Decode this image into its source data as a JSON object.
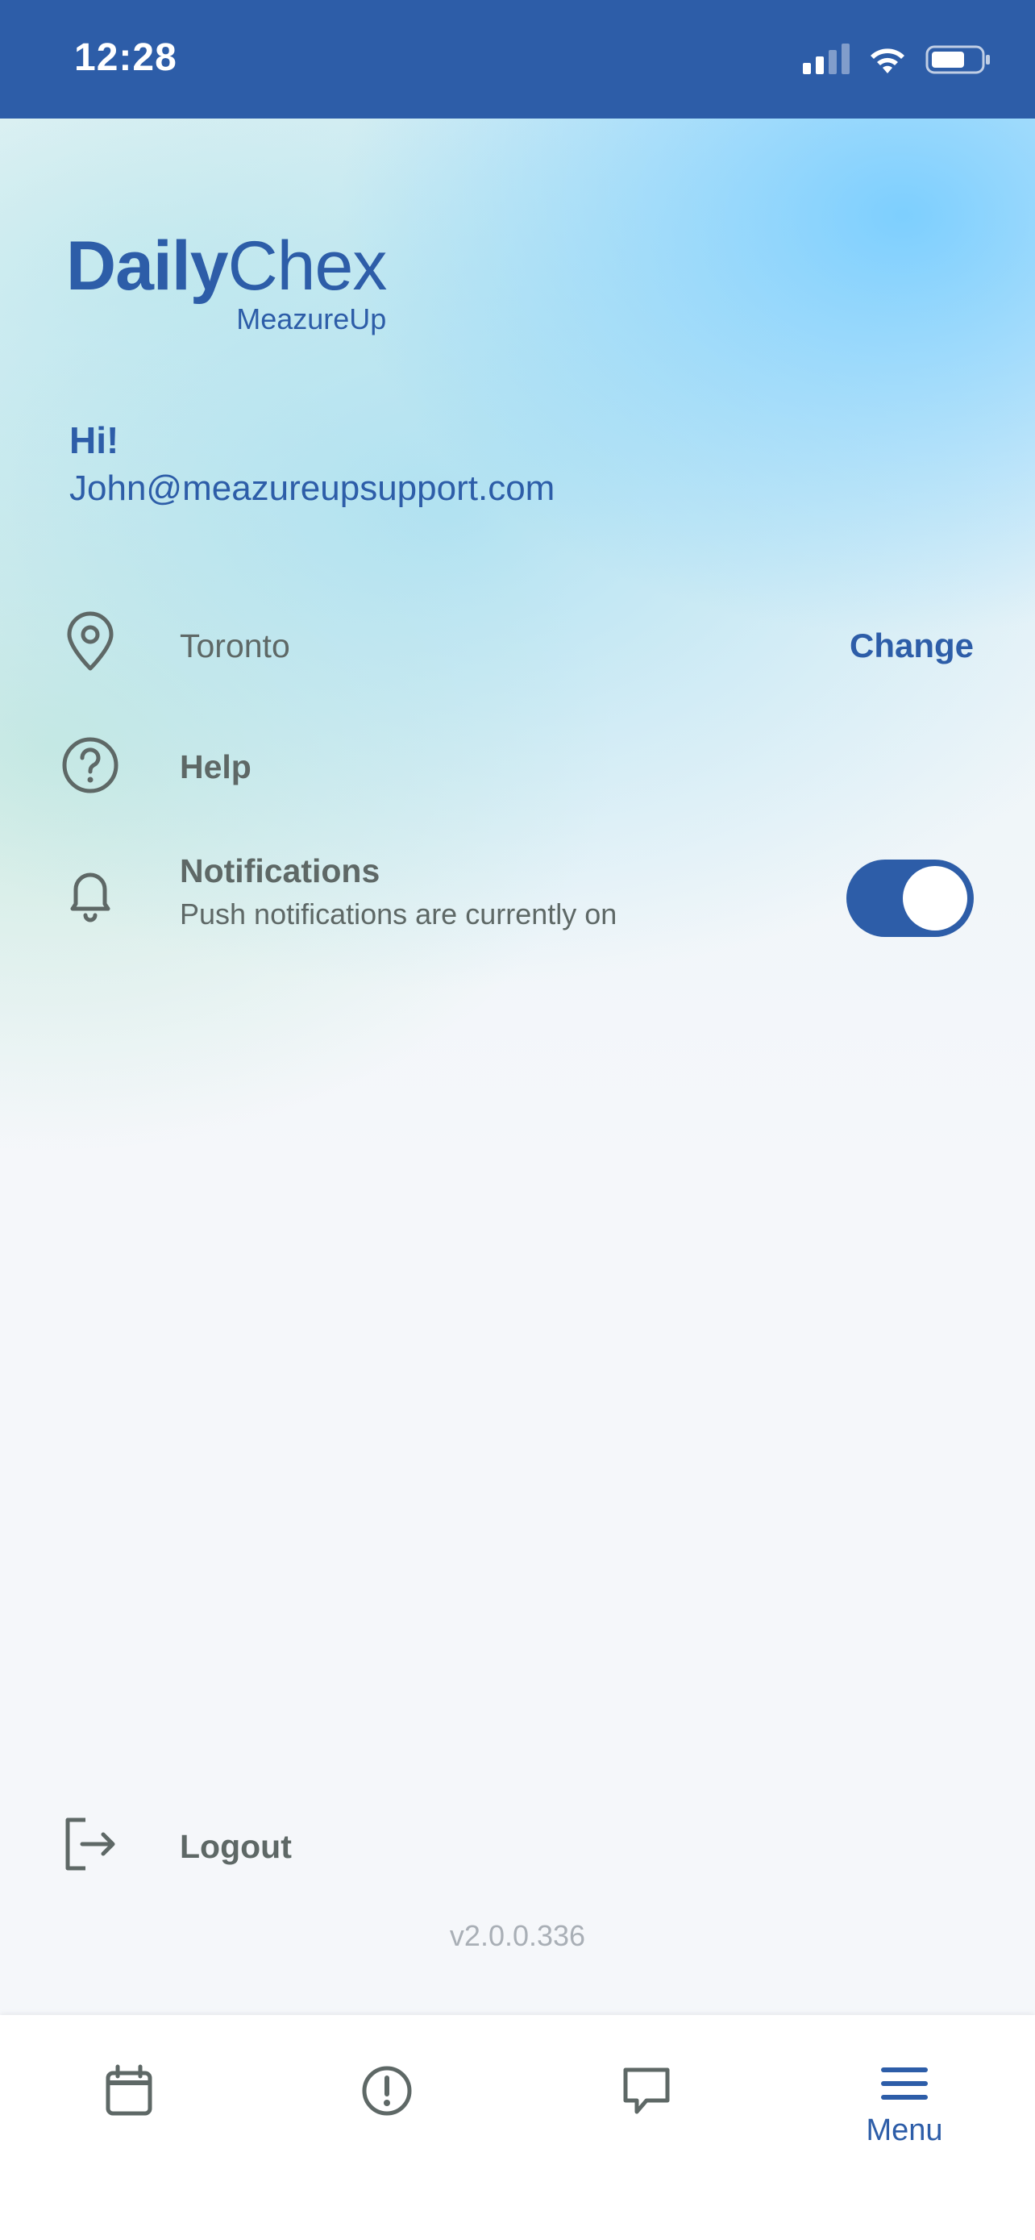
{
  "status_bar": {
    "time": "12:28"
  },
  "logo": {
    "main_bold": "Daily",
    "main_regular": "Chex",
    "sub": "MeazureUp"
  },
  "greeting": {
    "hi": "Hi!",
    "email": "John@meazureupsupport.com"
  },
  "menu": {
    "location": {
      "label": "Toronto",
      "action": "Change",
      "icon": "map-pin-icon"
    },
    "help": {
      "label": "Help",
      "icon": "help-circle-icon"
    },
    "notifications": {
      "label": "Notifications",
      "subtitle": "Push notifications are currently on",
      "icon": "bell-icon",
      "enabled": true
    },
    "logout": {
      "label": "Logout",
      "icon": "logout-icon"
    }
  },
  "version": "v2.0.0.336",
  "tab_bar": {
    "tabs": [
      {
        "icon": "calendar-icon",
        "label": ""
      },
      {
        "icon": "alert-circle-icon",
        "label": ""
      },
      {
        "icon": "message-icon",
        "label": ""
      },
      {
        "icon": "menu-icon",
        "label": "Menu",
        "active": true
      }
    ]
  },
  "colors": {
    "brand": "#2d5da8",
    "text_gray": "#5e6866",
    "version_gray": "#a9afb6"
  }
}
